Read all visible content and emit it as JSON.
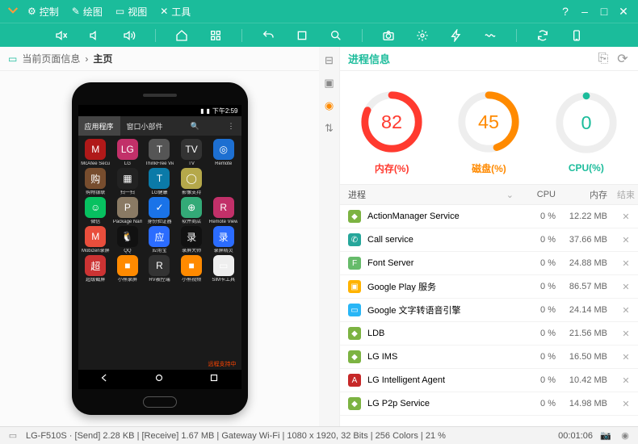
{
  "titlebar": {
    "menus": [
      {
        "icon": "⚙",
        "label": "控制"
      },
      {
        "icon": "✎",
        "label": "绘图"
      },
      {
        "icon": "▭",
        "label": "视图"
      },
      {
        "icon": "✕",
        "label": "工具"
      }
    ],
    "help": "?",
    "min": "–",
    "max": "□",
    "close": "✕"
  },
  "toolbar_icons": [
    "mute",
    "vol-down",
    "vol-up",
    "sep",
    "home",
    "grid",
    "sep",
    "undo",
    "square",
    "search",
    "sep",
    "camera",
    "gear",
    "bolt",
    "wave",
    "sep",
    "refresh",
    "phone-rect"
  ],
  "left": {
    "crumb_a": "当前页面信息",
    "crumb_sep": "›",
    "crumb_b": "主页",
    "phone": {
      "time": "下午2:59",
      "tab_apps": "应用程序",
      "tab_widgets": "窗口小部件",
      "bottom_text": "远程支持中",
      "apps": [
        {
          "name": "McAfee Security",
          "color": "#b01919",
          "g": "M"
        },
        {
          "name": "LG",
          "color": "#c23069",
          "g": "LG"
        },
        {
          "name": "ThinkFree Viewer",
          "color": "#555",
          "g": "T"
        },
        {
          "name": "TV",
          "color": "#333",
          "g": "TV"
        },
        {
          "name": "Remote",
          "color": "#1d6fd1",
          "g": "◎"
        },
        {
          "name": "购物银联",
          "color": "#774d2e",
          "g": "购"
        },
        {
          "name": "扫一扫",
          "color": "#222",
          "g": "▦"
        },
        {
          "name": "LG健康",
          "color": "#0b7aa8",
          "g": "T"
        },
        {
          "name": "影像支持",
          "color": "#b5a84a",
          "g": "◯"
        },
        {
          "name": "",
          "color": "transparent",
          "g": ""
        },
        {
          "name": "微信",
          "color": "#07c160",
          "g": "☺"
        },
        {
          "name": "Package Names",
          "color": "#8a7a64",
          "g": "P"
        },
        {
          "name": "身份验证器",
          "color": "#1a73e8",
          "g": "✓"
        },
        {
          "name": "软件商店",
          "color": "#3a7",
          "g": "⊕"
        },
        {
          "name": "Remote View",
          "color": "#c23069",
          "g": "R"
        },
        {
          "name": "Mobizen录屏",
          "color": "#e94e3c",
          "g": "M"
        },
        {
          "name": "QQ",
          "color": "#111",
          "g": "🐧"
        },
        {
          "name": "应用宝",
          "color": "#2b6cff",
          "g": "应"
        },
        {
          "name": "录屏大师",
          "color": "#111",
          "g": "录"
        },
        {
          "name": "录屏精灵",
          "color": "#2b6cff",
          "g": "录"
        },
        {
          "name": "超级截屏",
          "color": "#c33",
          "g": "超"
        },
        {
          "name": "小熊录屏",
          "color": "#ff8a00",
          "g": "■"
        },
        {
          "name": "RV被控端",
          "color": "#333",
          "g": "R"
        },
        {
          "name": "小熊视频",
          "color": "#ff8a00",
          "g": "■"
        },
        {
          "name": "SIM卡工具",
          "color": "#eee",
          "g": "▭"
        }
      ]
    }
  },
  "right": {
    "title": "进程信息",
    "gauges": [
      {
        "value": 82,
        "label": "内存(%)",
        "color": "#ff3a2f"
      },
      {
        "value": 45,
        "label": "磁盘(%)",
        "color": "#ff8a00"
      },
      {
        "value": 0,
        "label": "CPU(%)",
        "color": "#1bbc9b"
      }
    ],
    "columns": {
      "name": "进程",
      "cpu": "CPU",
      "mem": "内存",
      "end": "结束"
    },
    "processes": [
      {
        "name": "ActionManager Service",
        "cpu": "0 %",
        "mem": "12.22 MB",
        "ic": "#7cb342",
        "g": "◆"
      },
      {
        "name": "Call service",
        "cpu": "0 %",
        "mem": "37.66 MB",
        "ic": "#26a69a",
        "g": "✆"
      },
      {
        "name": "Font Server",
        "cpu": "0 %",
        "mem": "24.88 MB",
        "ic": "#66bb6a",
        "g": "F"
      },
      {
        "name": "Google Play 服务",
        "cpu": "0 %",
        "mem": "86.57 MB",
        "ic": "#ffb300",
        "g": "▣"
      },
      {
        "name": "Google 文字转语音引擎",
        "cpu": "0 %",
        "mem": "24.14 MB",
        "ic": "#29b6f6",
        "g": "▭"
      },
      {
        "name": "LDB",
        "cpu": "0 %",
        "mem": "21.56 MB",
        "ic": "#7cb342",
        "g": "◆"
      },
      {
        "name": "LG IMS",
        "cpu": "0 %",
        "mem": "16.50 MB",
        "ic": "#7cb342",
        "g": "◆"
      },
      {
        "name": "LG Intelligent Agent",
        "cpu": "0 %",
        "mem": "10.42 MB",
        "ic": "#c62828",
        "g": "A"
      },
      {
        "name": "LG P2p Service",
        "cpu": "0 %",
        "mem": "14.98 MB",
        "ic": "#7cb342",
        "g": "◆"
      }
    ]
  },
  "status": {
    "text": "LG-F510S · [Send] 2.28 KB | [Receive] 1.67 MB | Gateway Wi-Fi | 1080 x 1920, 32 Bits | 256 Colors | 21 %",
    "time": "00:01:06"
  }
}
